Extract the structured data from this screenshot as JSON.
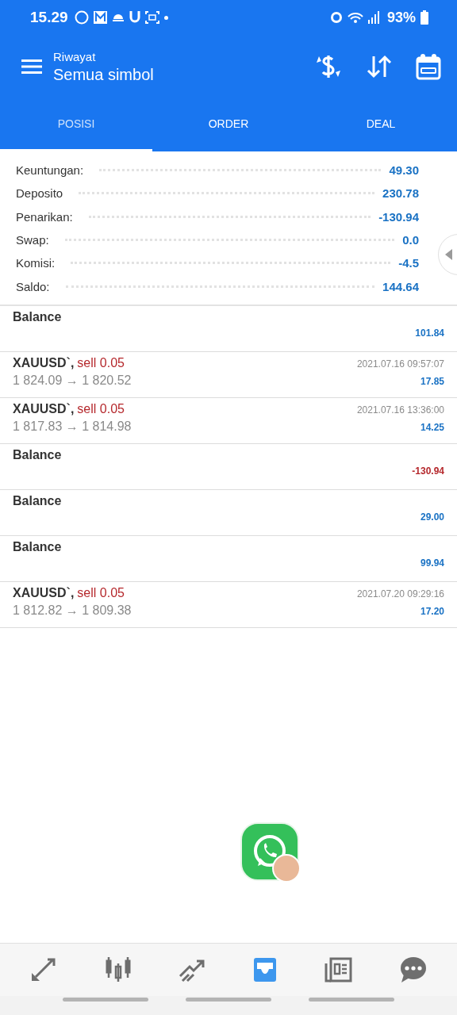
{
  "status_bar": {
    "time": "15.29",
    "battery": "93%"
  },
  "header": {
    "subtitle": "Riwayat",
    "title": "Semua simbol"
  },
  "tabs": [
    {
      "label": "POSISI",
      "selected": true
    },
    {
      "label": "ORDER",
      "selected": false
    },
    {
      "label": "DEAL",
      "selected": false
    }
  ],
  "summary": [
    {
      "label": "Keuntungan:",
      "value": "49.30"
    },
    {
      "label": "Deposito",
      "value": "230.78"
    },
    {
      "label": "Penarikan:",
      "value": "-130.94"
    },
    {
      "label": "Swap:",
      "value": "0.0"
    },
    {
      "label": "Komisi:",
      "value": "-4.5"
    },
    {
      "label": "Saldo:",
      "value": "144.64"
    }
  ],
  "deals": [
    {
      "kind": "balance",
      "title": "Balance",
      "profit": "101.84",
      "loss": false
    },
    {
      "kind": "trade",
      "symbol": "XAUUSD`,",
      "side": "sell 0.05",
      "prices": "1 824.09 → 1 820.52",
      "time": "2021.07.16 09:57:07",
      "profit": "17.85",
      "loss": false
    },
    {
      "kind": "trade",
      "symbol": "XAUUSD`,",
      "side": "sell 0.05",
      "prices": "1 817.83 → 1 814.98",
      "time": "2021.07.16 13:36:00",
      "profit": "14.25",
      "loss": false
    },
    {
      "kind": "balance",
      "title": "Balance",
      "profit": "-130.94",
      "loss": true
    },
    {
      "kind": "balance",
      "title": "Balance",
      "profit": "29.00",
      "loss": false
    },
    {
      "kind": "balance",
      "title": "Balance",
      "profit": "99.94",
      "loss": false
    },
    {
      "kind": "trade",
      "symbol": "XAUUSD`,",
      "side": "sell 0.05",
      "prices": "1 812.82 → 1 809.38",
      "time": "2021.07.20 09:29:16",
      "profit": "17.20",
      "loss": false
    }
  ],
  "bottom_nav": [
    {
      "kind": "quotes",
      "selected": false
    },
    {
      "kind": "charts",
      "selected": false
    },
    {
      "kind": "trade",
      "selected": false
    },
    {
      "kind": "history",
      "selected": true
    },
    {
      "kind": "news",
      "selected": false
    },
    {
      "kind": "chat",
      "selected": false
    }
  ]
}
